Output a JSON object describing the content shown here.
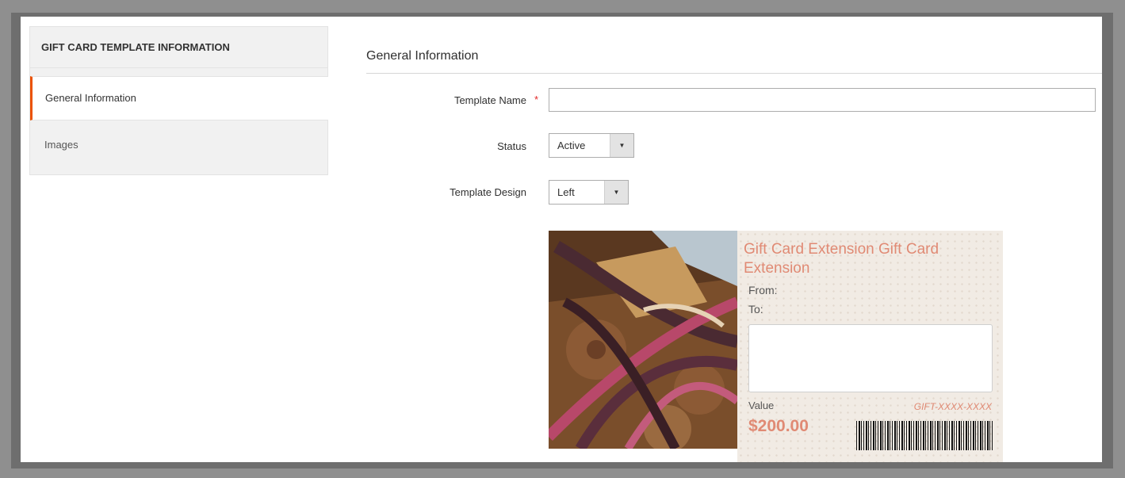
{
  "sidebar": {
    "title": "GIFT CARD TEMPLATE INFORMATION",
    "items": [
      {
        "label": "General Information",
        "active": true
      },
      {
        "label": "Images",
        "active": false
      }
    ]
  },
  "section": {
    "title": "General Information"
  },
  "form": {
    "template_name": {
      "label": "Template Name",
      "required_mark": "*",
      "value": ""
    },
    "status": {
      "label": "Status",
      "selected": "Active"
    },
    "template_design": {
      "label": "Template Design",
      "selected": "Left"
    }
  },
  "preview": {
    "title": "Gift Card Extension Gift Card Extension",
    "from_label": "From:",
    "to_label": "To:",
    "value_label": "Value",
    "code": "GIFT-XXXX-XXXX",
    "value": "$200.00"
  },
  "colors": {
    "accent": "#eb5202",
    "card_text": "#e08a74",
    "required": "#e22626"
  }
}
